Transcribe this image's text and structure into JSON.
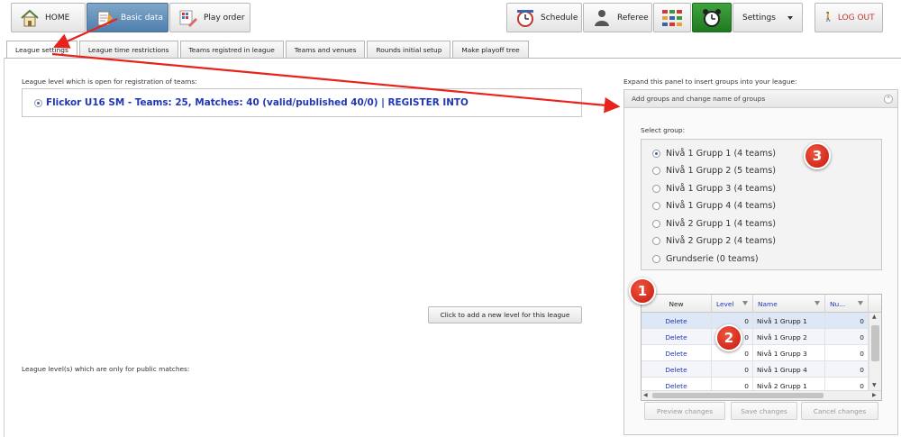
{
  "toolbar": {
    "home": "HOME",
    "basic_data": "Basic data",
    "play_order": "Play order",
    "schedule": "Schedule",
    "referee": "Referee",
    "settings": "Settings",
    "logout": "LOG OUT"
  },
  "tabs": [
    {
      "label": "League settings"
    },
    {
      "label": "League time restrictions"
    },
    {
      "label": "Teams registred in league"
    },
    {
      "label": "Teams and venues"
    },
    {
      "label": "Rounds initial setup"
    },
    {
      "label": "Make playoff tree"
    }
  ],
  "main": {
    "open_levels_label": "League level which is open for registration of teams:",
    "level_text": "Flickor U16 SM - Teams: 25, Matches: 40 (valid/published 40/0) | REGISTER INTO",
    "add_level_button": "Click to add a new level for this league",
    "public_levels_label": "League level(s) which are only for public matches:"
  },
  "panel": {
    "expand_label": "Expand this panel to insert groups into your league:",
    "header": "Add groups and change name of groups",
    "select_group_label": "Select group:",
    "groups": [
      "Nivå 1 Grupp 1 (4 teams)",
      "Nivå 1 Grupp 2 (5 teams)",
      "Nivå 1 Grupp 3 (4 teams)",
      "Nivå 1 Grupp 4 (4 teams)",
      "Nivå 2 Grupp 1 (4 teams)",
      "Nivå 2 Grupp 2 (4 teams)",
      "Grundserie (0 teams)"
    ],
    "grid": {
      "headers": {
        "new": "New",
        "level": "Level",
        "name": "Name",
        "number": "Nu..."
      },
      "rows": [
        {
          "action": "Delete",
          "level": "0",
          "name": "Nivå 1 Grupp 1",
          "number": "0"
        },
        {
          "action": "Delete",
          "level": "0",
          "name": "Nivå 1 Grupp 2",
          "number": "0"
        },
        {
          "action": "Delete",
          "level": "0",
          "name": "Nivå 1 Grupp 3",
          "number": "0"
        },
        {
          "action": "Delete",
          "level": "0",
          "name": "Nivå 1 Grupp 4",
          "number": "0"
        },
        {
          "action": "Delete",
          "level": "0",
          "name": "Nivå 2 Grupp 1",
          "number": "0"
        }
      ]
    },
    "buttons": {
      "preview": "Preview changes",
      "save": "Save changes",
      "cancel": "Cancel changes"
    }
  },
  "annotations": {
    "badge1": "1",
    "badge2": "2",
    "badge3": "3",
    "arrow_color": "#e8231b"
  }
}
